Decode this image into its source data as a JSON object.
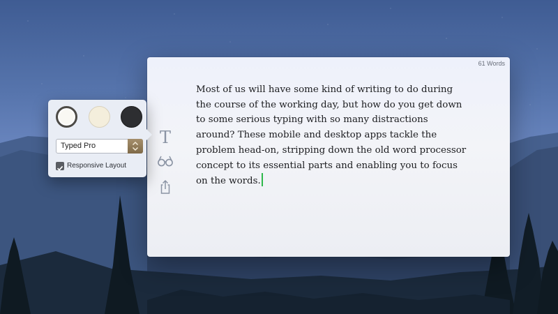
{
  "editor": {
    "word_count": "61 Words",
    "text": "Most of us will have some kind of writing to do during the course of the working day, but how do you get down to some serious typing with so many distractions around? These mobile and desktop apps tackle the problem head-on, stripping down the old word processor concept to its essential parts and enabling you to focus on the words.",
    "caret_color": "#2db84a"
  },
  "side_toolbar": {
    "font_tool_glyph": "T",
    "items": [
      {
        "icon": "font-icon"
      },
      {
        "icon": "glasses-icon"
      },
      {
        "icon": "share-icon"
      }
    ]
  },
  "settings_popover": {
    "themes": [
      {
        "name": "white",
        "color": "#f9f8f3",
        "selected": true
      },
      {
        "name": "cream",
        "color": "#f4eedc",
        "selected": false
      },
      {
        "name": "dark",
        "color": "#2d2e31",
        "selected": false
      }
    ],
    "font_select": {
      "value": "Typed Pro"
    },
    "responsive_layout": {
      "label": "Responsive Layout",
      "checked": true
    }
  }
}
